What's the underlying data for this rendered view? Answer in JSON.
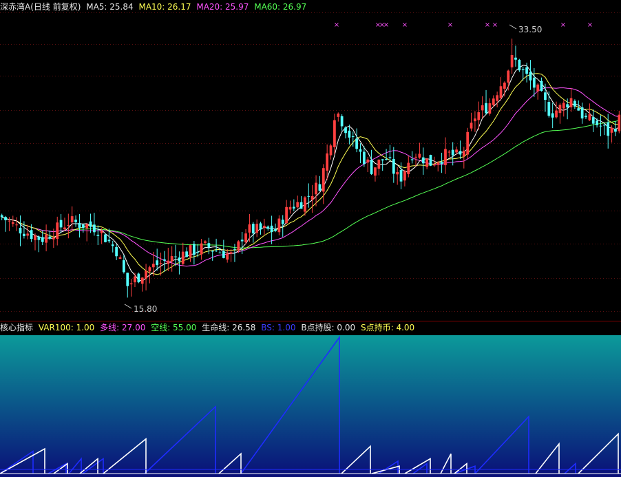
{
  "header": {
    "title": "深赤湾A(日线 前复权)",
    "ma5": "MA5: 25.84",
    "ma10": "MA10: 26.17",
    "ma20": "MA20: 25.97",
    "ma60": "MA60: 26.97"
  },
  "indicator": {
    "name": "核心指标",
    "var100": "VAR100: 1.00",
    "long": "多线: 27.00",
    "short": "空线: 55.00",
    "life": "生命线: 26.58",
    "bs": "BS: 1.00",
    "b_hold": "B点持股: 0.00",
    "s_hold": "S点持币: 4.00"
  },
  "colors": {
    "up": "#ff4040",
    "down": "#54ffff",
    "ma5": "#ffffff",
    "ma10": "#ffff54",
    "ma20": "#ff54ff",
    "ma60": "#54ff54",
    "marker": "#ff54ff",
    "panel_top": "#0c9a9a",
    "panel_bottom": "#0a0f78",
    "bs_line": "#1e2cff",
    "saw_line": "#ffffff"
  },
  "chart_data": {
    "type": "candlestick",
    "price_range": [
      14.5,
      35.2
    ],
    "max_label": "33.50",
    "min_label": "15.80",
    "max_value": 33.5,
    "min_value": 15.8,
    "markers_symbol": "×",
    "markers_count": 10,
    "indicator_panel": {
      "type": "line",
      "y_range": [
        0,
        55
      ],
      "series": [
        {
          "name": "BS",
          "color": "blue"
        },
        {
          "name": "B点持股",
          "color": "white"
        }
      ]
    }
  }
}
